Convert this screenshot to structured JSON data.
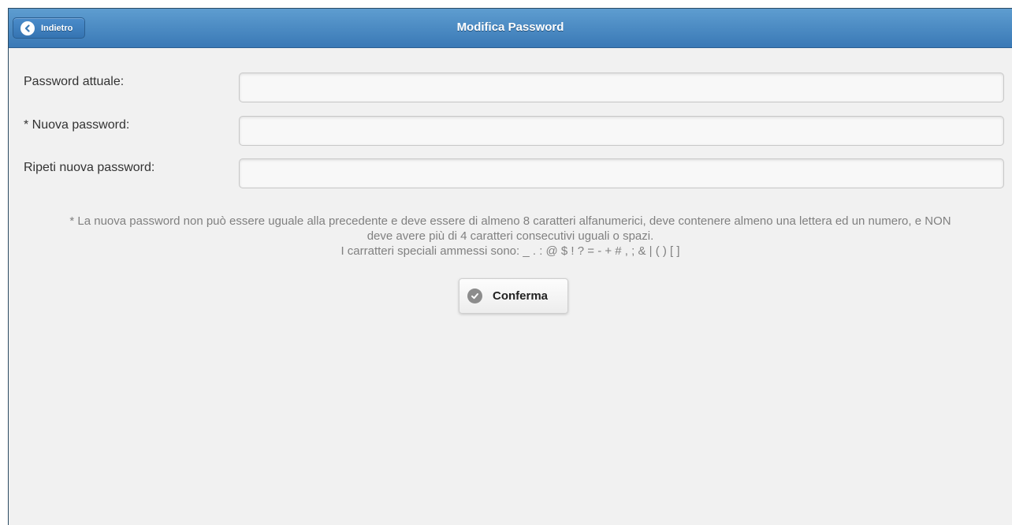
{
  "header": {
    "title": "Modifica Password",
    "back_label": "Indietro"
  },
  "form": {
    "fields": [
      {
        "label": "Password attuale:",
        "value": ""
      },
      {
        "label": "* Nuova password:",
        "value": ""
      },
      {
        "label": "Ripeti nuova password:",
        "value": ""
      }
    ]
  },
  "note": {
    "line1": "* La nuova password non può essere uguale alla precedente e deve essere di almeno 8 caratteri alfanumerici, deve contenere almeno una lettera ed un numero, e NON",
    "line2": "deve avere più di 4 caratteri consecutivi uguali o spazi.",
    "line3": "I carratteri speciali ammessi sono: _ . : @ $ ! ? = - + # , ; & | ( ) [ ]"
  },
  "confirm": {
    "label": "Conferma"
  },
  "colors": {
    "header_top": "#5e9dd0",
    "header_bottom": "#3a79b6",
    "background": "#f1f1f1"
  },
  "icons": {
    "back": "chevron-left-circle-icon",
    "confirm": "check-circle-icon"
  }
}
